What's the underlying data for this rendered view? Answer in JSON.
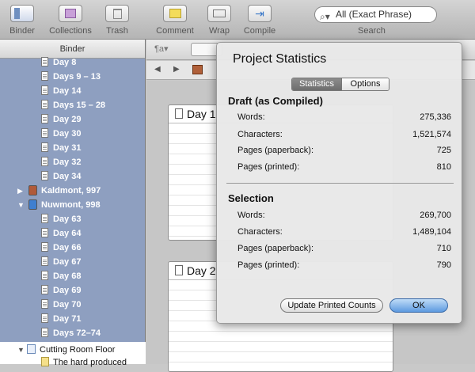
{
  "toolbar": {
    "binder_label": "Binder",
    "collections_label": "Collections",
    "trash_label": "Trash",
    "comment_label": "Comment",
    "wrap_label": "Wrap",
    "compile_label": "Compile",
    "search_value": "All (Exact Phrase)",
    "search_label": "Search"
  },
  "binder": {
    "header": "Binder",
    "items": [
      {
        "label": "Day 8"
      },
      {
        "label": "Days 9 – 13"
      },
      {
        "label": "Day 14"
      },
      {
        "label": "Days 15 – 28"
      },
      {
        "label": "Day 29"
      },
      {
        "label": "Day 30"
      },
      {
        "label": "Day 31"
      },
      {
        "label": "Day 32"
      },
      {
        "label": "Day 34"
      }
    ],
    "folder_kaldmont": "Kaldmont, 997",
    "folder_nuwmont": "Nuwmont, 998",
    "items2": [
      {
        "label": "Day 63"
      },
      {
        "label": "Day 64"
      },
      {
        "label": "Day 66"
      },
      {
        "label": "Day 67"
      },
      {
        "label": "Day 68"
      },
      {
        "label": "Day 69"
      },
      {
        "label": "Day 70"
      },
      {
        "label": "Day 71"
      },
      {
        "label": "Days 72–74"
      }
    ],
    "cutting_room": "Cutting Room Floor",
    "cutting_child": "The hard produced"
  },
  "editor": {
    "card1_title": "Day 1",
    "card2_title": "Day 2"
  },
  "stats": {
    "title": "Project Statistics",
    "tab_statistics": "Statistics",
    "tab_options": "Options",
    "draft_title": "Draft (as Compiled)",
    "draft": [
      {
        "label": "Words:",
        "value": "275,336"
      },
      {
        "label": "Characters:",
        "value": "1,521,574"
      },
      {
        "label": "Pages (paperback):",
        "value": "725"
      },
      {
        "label": "Pages (printed):",
        "value": "810"
      }
    ],
    "selection_title": "Selection",
    "selection": [
      {
        "label": "Words:",
        "value": "269,700"
      },
      {
        "label": "Characters:",
        "value": "1,489,104"
      },
      {
        "label": "Pages (paperback):",
        "value": "710"
      },
      {
        "label": "Pages (printed):",
        "value": "790"
      }
    ],
    "update_button": "Update Printed Counts",
    "ok_button": "OK"
  },
  "colors": {
    "binder_bg": "#8e9fc0",
    "ok_accent": "#5d9ae0",
    "folder_kaldmont": "#b05a3a",
    "folder_nuwmont": "#3f7fd0"
  }
}
